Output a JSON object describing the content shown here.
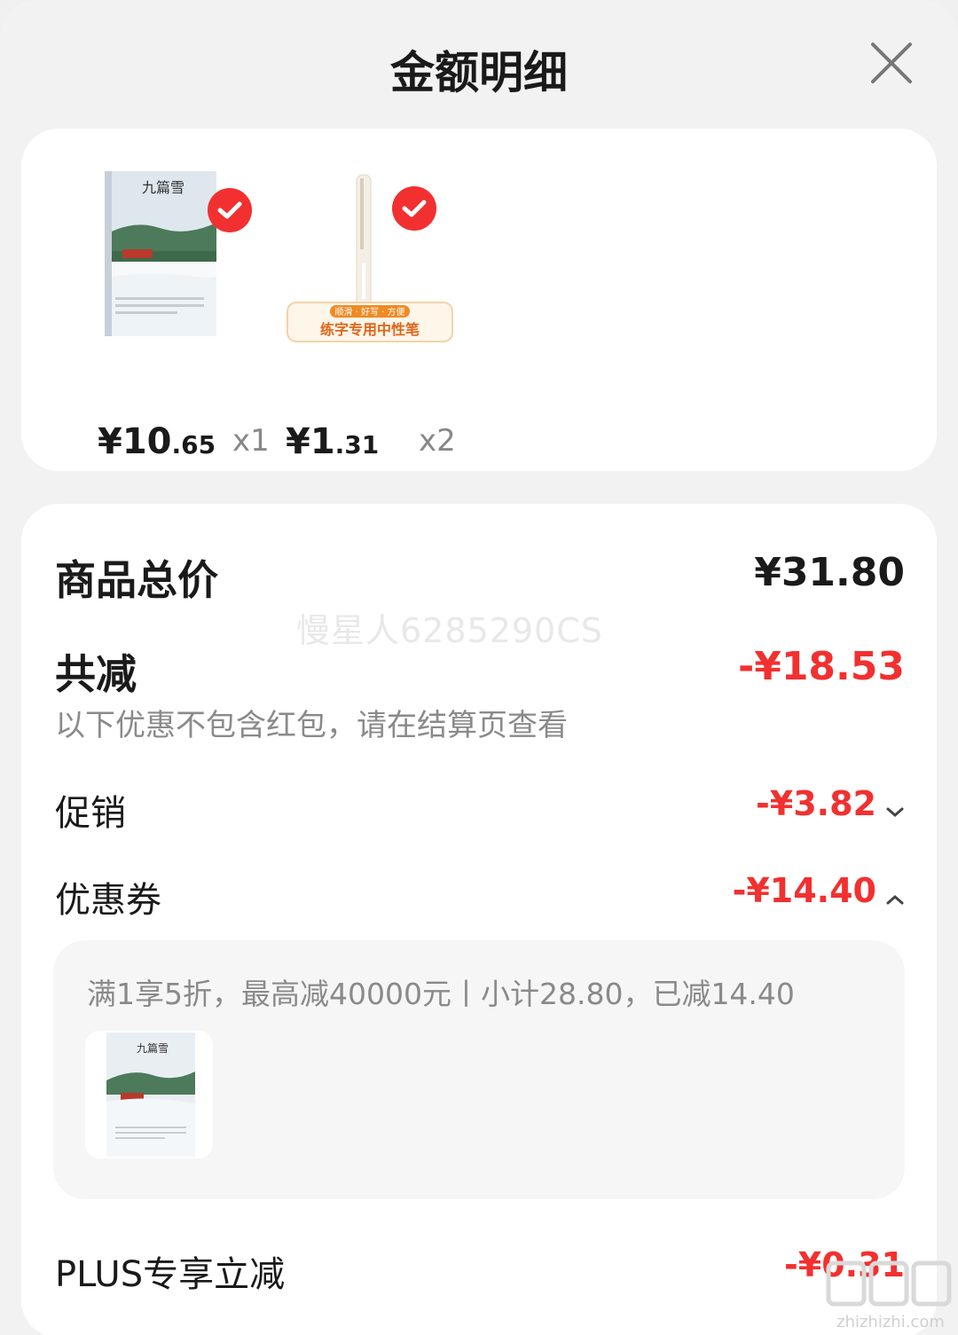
{
  "header": {
    "title": "金额明细"
  },
  "products": [
    {
      "image_icon": "book-cover-jiu-pian-xue",
      "cover_title": "九篇雪",
      "price_int": "¥10",
      "price_dec": ".65",
      "qty": "x1",
      "selected": true
    },
    {
      "image_icon": "gel-pen",
      "banner_top": "顺滑 · 好写 · 方便",
      "banner_main": "练字专用中性笔",
      "price_int": "¥1",
      "price_dec": ".31",
      "qty": "x2",
      "selected": true
    }
  ],
  "summary": {
    "total_label": "商品总价",
    "total_value": "¥31.80",
    "watermark": "慢星人6285290CS",
    "discount_label": "共减",
    "discount_value": "-¥18.53",
    "discount_note": "以下优惠不包含红包，请在结算页查看",
    "promo_label": "促销",
    "promo_value": "-¥3.82",
    "coupon_label": "优惠券",
    "coupon_value": "-¥14.40",
    "coupon_detail": "满1享5折，最高减40000元丨小计28.80，已减14.40",
    "plus_label": "PLUS专享立减",
    "plus_value": "-¥0.31"
  },
  "site_watermark": "zhizhizhi.com",
  "colors": {
    "accent_red": "#f23030",
    "background": "#f2f2f2",
    "card": "#ffffff",
    "muted_text": "#8a8a8a"
  }
}
